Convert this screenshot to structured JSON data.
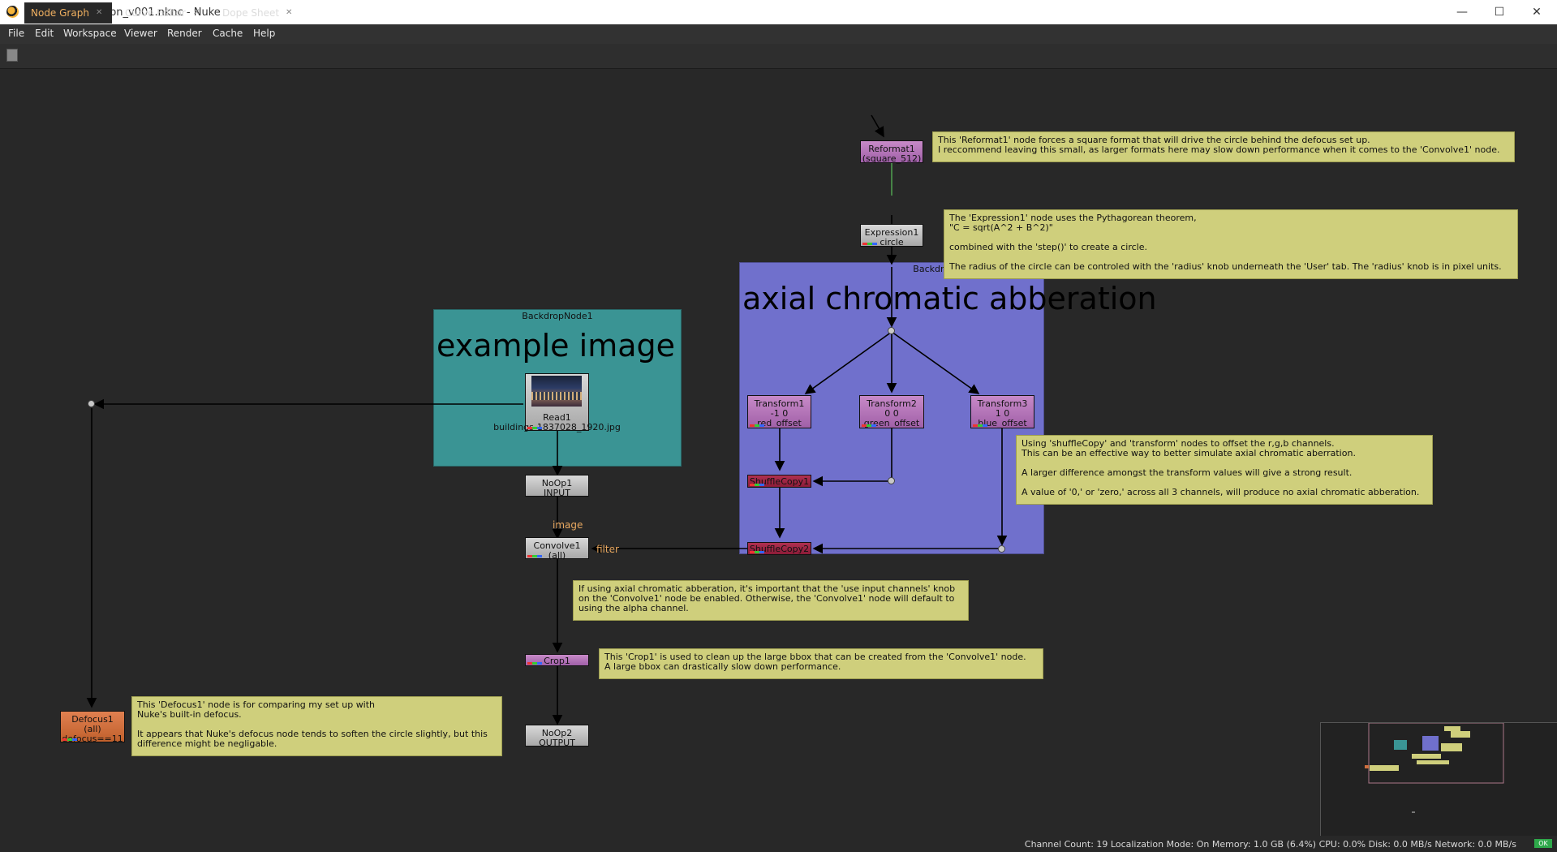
{
  "window": {
    "title": "defocusExpression_v001.nknc - Nuke",
    "min": "—",
    "max": "☐",
    "close": "✕"
  },
  "menu": [
    "File",
    "Edit",
    "Workspace",
    "Viewer",
    "Render",
    "Cache",
    "Help"
  ],
  "tabs": [
    {
      "label": "Node Graph",
      "close": "✕"
    },
    {
      "label": "Curve Editor",
      "close": "✕"
    },
    {
      "label": "Dope Sheet",
      "close": "✕"
    }
  ],
  "backdrops": {
    "b1": {
      "label": "BackdropNode1",
      "big": "example image",
      "color": "#3a9494"
    },
    "b2": {
      "label": "BackdropNode2",
      "big": "axial chromatic abberation",
      "color": "#7070cc"
    }
  },
  "nodes": {
    "reformat1": {
      "l1": "Reformat1",
      "l2": "(square_512)"
    },
    "expression1": {
      "l1": "Expression1",
      "l2": "circle"
    },
    "transform1": {
      "l1": "Transform1",
      "l2": "-1 0",
      "l3": "red_offset"
    },
    "transform2": {
      "l1": "Transform2",
      "l2": "0 0",
      "l3": "green_offset"
    },
    "transform3": {
      "l1": "Transform3",
      "l2": "1 0",
      "l3": "blue_offset"
    },
    "shufflecopy1": {
      "l1": "ShuffleCopy1"
    },
    "shufflecopy2": {
      "l1": "ShuffleCopy2"
    },
    "read1": {
      "l1": "Read1",
      "l2": "buildings-1837028_1920.jpg"
    },
    "noop1": {
      "l1": "NoOp1",
      "l2": "INPUT"
    },
    "convolve1": {
      "l1": "Convolve1",
      "l2": "(all)"
    },
    "crop1": {
      "l1": "Crop1"
    },
    "noop2": {
      "l1": "NoOp2",
      "l2": "OUTPUT"
    },
    "defocus1": {
      "l1": "Defocus1",
      "l2": "(all)",
      "l3": "defocus==11"
    }
  },
  "edge_labels": {
    "image": "image",
    "filter": "filter"
  },
  "stickies": {
    "reformat": "This 'Reformat1' node forces a square format that will drive the circle behind the defocus set up.\nI reccommend leaving this small, as larger formats here may slow down performance when it comes to the 'Convolve1' node.",
    "expression": "The 'Expression1' node uses the Pythagorean theorem,\n\"C = sqrt(A^2 + B^2)\"\n\ncombined with the 'step()' to create a circle.\n\nThe radius of the circle can be controled with the 'radius' knob underneath the 'User' tab. The 'radius' knob is in pixel units.",
    "shuffle": "Using 'shuffleCopy' and 'transform' nodes to offset the r,g,b channels.\nThis can be an effective way to better simulate axial chromatic aberration.\n\nA larger difference amongst the transform values will give a strong result.\n\nA value of '0,' or 'zero,' across all 3 channels, will produce no axial chromatic abberation.",
    "convolve": "If using axial chromatic abberation, it's important that the 'use input channels' knob\non the 'Convolve1' node be enabled. Otherwise, the 'Convolve1' node will default to\nusing the alpha channel.",
    "crop": "This 'Crop1' is used to clean up the large bbox that can be created from the 'Convolve1' node.\nA large bbox can drastically slow down performance.",
    "defocus": "This 'Defocus1' node is for comparing my set up with\nNuke's built-in defocus.\n\nIt appears that Nuke's defocus node tends to soften the circle slightly, but this\ndifference might be negligable."
  },
  "status": {
    "text": "Channel Count: 19  Localization Mode: On  Memory: 1.0 GB (6.4%)  CPU: 0.0%  Disk: 0.0 MB/s  Network: 0.0 MB/s",
    "ok": "OK"
  },
  "colors": {
    "background": "#282828",
    "edge": "#000000",
    "label": "#e8a860",
    "sticky": "#cfcf7c"
  }
}
